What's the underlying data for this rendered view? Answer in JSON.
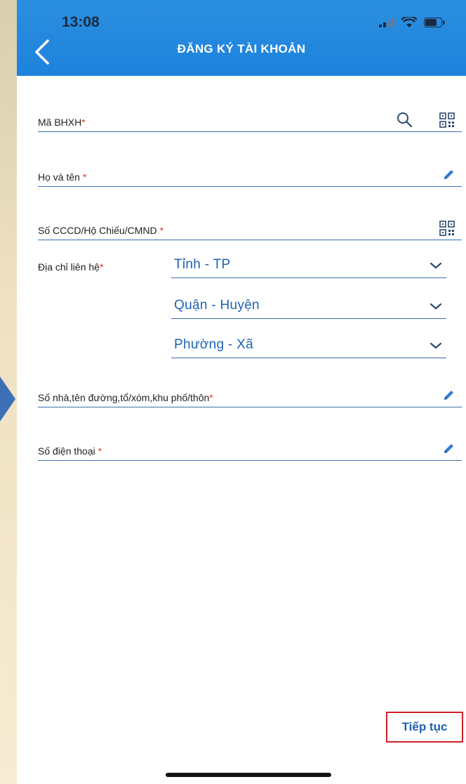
{
  "status_bar": {
    "time": "13:08"
  },
  "header": {
    "title": "ĐĂNG KÝ TÀI KHOẢN"
  },
  "form": {
    "bhxh_label": "Mã BHXH",
    "name_label": "Họ và tên",
    "id_label": "Số CCCD/Hộ Chiếu/CMND",
    "address_label": "Địa chỉ liên hệ",
    "province_value": "Tỉnh - TP",
    "district_value": "Quận - Huyện",
    "ward_value": "Phường - Xã",
    "street_label": "Số nhà,tên đường,tổ/xóm,khu phố/thôn",
    "phone_label": "Số điện thoại",
    "required_mark": "*"
  },
  "actions": {
    "continue_label": "Tiếp tục"
  },
  "colors": {
    "header": "#1d82dc",
    "accent": "#1e63b5",
    "required": "#d8312c",
    "highlight_border": "#d21f27"
  }
}
